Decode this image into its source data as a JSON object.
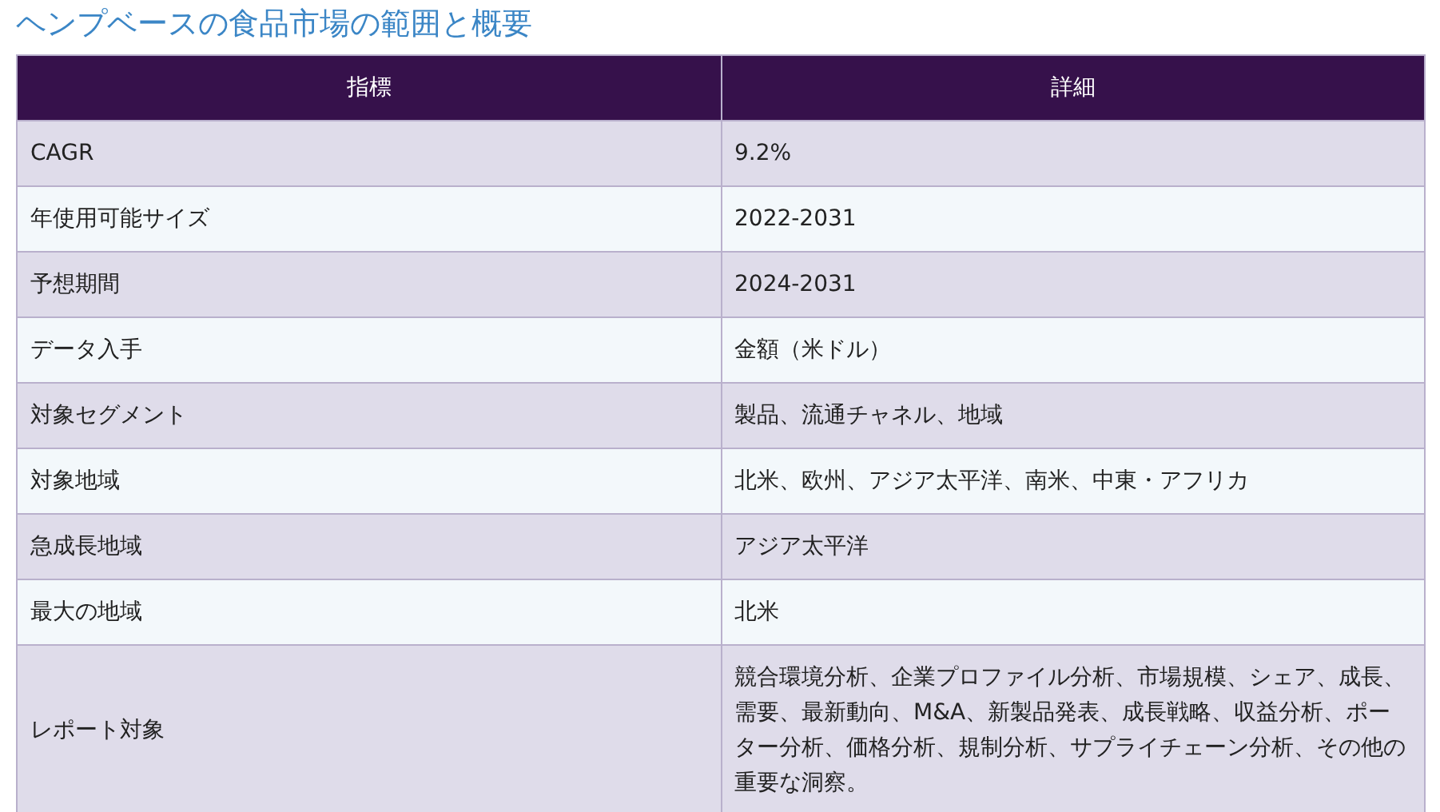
{
  "title": "ヘンプベースの食品市場の範囲と概要",
  "table": {
    "columns": [
      "指標",
      "詳細"
    ],
    "rows": [
      [
        "CAGR",
        "9.2%"
      ],
      [
        "年使用可能サイズ",
        "2022-2031"
      ],
      [
        "予想期間",
        "2024-2031"
      ],
      [
        "データ入手",
        "金額（米ドル）"
      ],
      [
        "対象セグメント",
        "製品、流通チャネル、地域"
      ],
      [
        "対象地域",
        "北米、欧州、アジア太平洋、南米、中東・アフリカ"
      ],
      [
        "急成長地域",
        "アジア太平洋"
      ],
      [
        "最大の地域",
        "北米"
      ],
      [
        "レポート対象",
        "競合環境分析、企業プロファイル分析、市場規模、シェア、成長、需要、最新動向、M&A、新製品発表、成長戦略、収益分析、ポーター分析、価格分析、規制分析、サプライチェーン分析、その他の重要な洞察。"
      ]
    ]
  }
}
